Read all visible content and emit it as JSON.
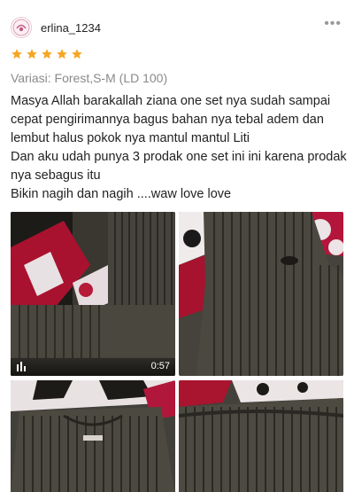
{
  "review": {
    "username": "erlina_1234",
    "rating": 5,
    "star_color": "#F5A623",
    "variant": "Variasi: Forest,S-M (LD 100)",
    "lines": [
      "Masya Allah barakallah  ziana one set nya sudah sampai",
      "cepat pengirimannya bagus bahan nya tebal adem dan",
      "lembut halus pokok nya mantul mantul  Liti",
      "Dan aku udah punya 3 prodak one set ini ini karena prodak",
      "nya sebagus itu",
      "Bikin nagih dan nagih ....waw love love"
    ]
  },
  "media": {
    "video_duration": "0:57",
    "items": [
      {
        "type": "video",
        "icon": "video-icon"
      },
      {
        "type": "image"
      },
      {
        "type": "image"
      },
      {
        "type": "image"
      }
    ]
  },
  "icons": {
    "more": "more-options-icon",
    "avatar": "avatar"
  }
}
